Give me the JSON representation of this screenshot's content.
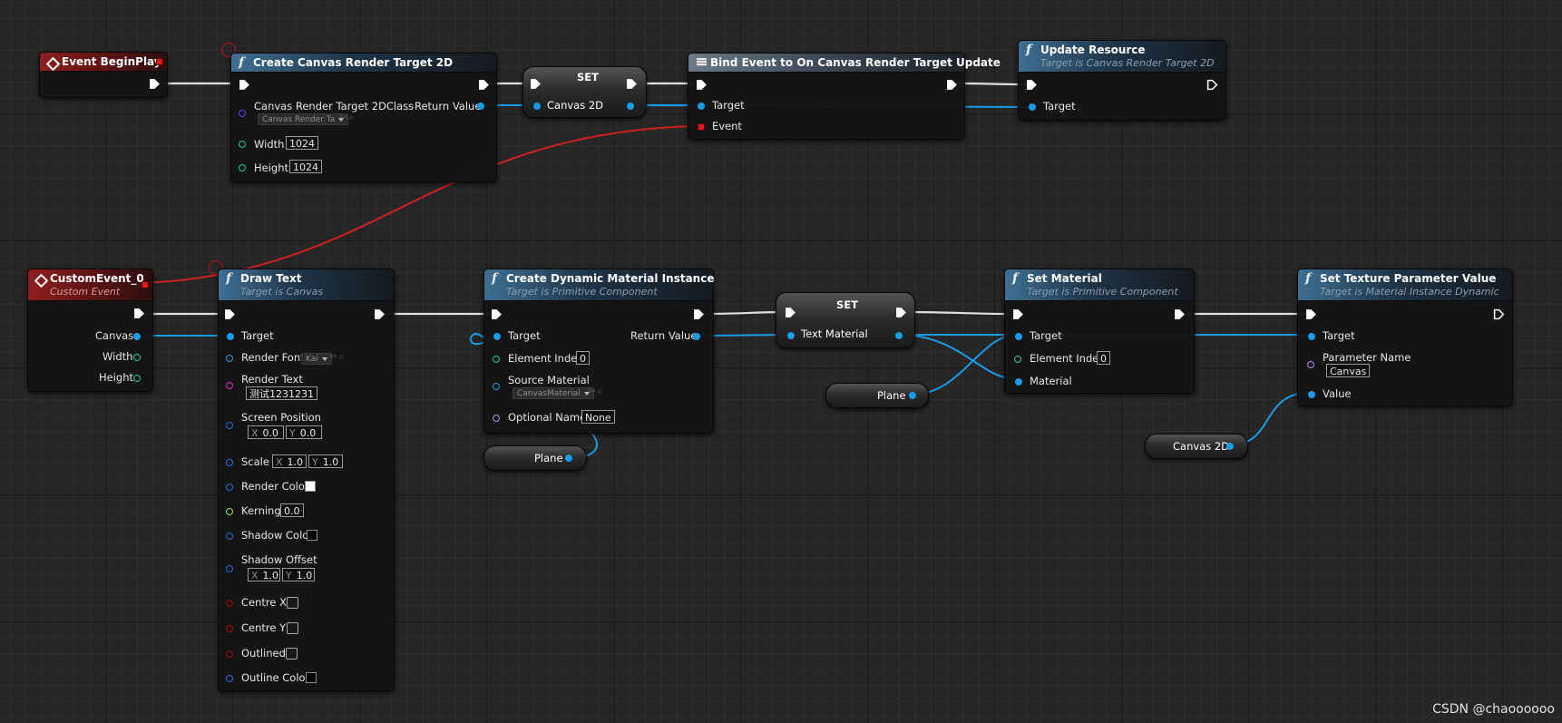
{
  "colors": {
    "exec_pin": "#ffffff",
    "object_pin": "#1a9be6",
    "integer_pin": "#1fc7a6",
    "class_pin": "#6a3fe6",
    "string_pin": "#e52dd6",
    "name_pin": "#b487f7",
    "float_pin": "#9be24f",
    "struct_pin": "#2a6cd8",
    "bool_pin": "#a50d0d",
    "event_header": "#8e1f1f",
    "function_header": "#3f6f93",
    "delegate_pin": "#e01818"
  },
  "nodes": {
    "event_beginplay": {
      "title": "Event BeginPlay"
    },
    "create_canvas_rt": {
      "title": "Create Canvas Render Target 2D",
      "class_label": "Canvas Render Target 2DClass",
      "class_value": "Canvas Render Ta",
      "return_label": "Return Value",
      "width_label": "Width",
      "width_value": "1024",
      "height_label": "Height",
      "height_value": "1024"
    },
    "set_canvas": {
      "title": "SET",
      "pin_label": "Canvas 2D"
    },
    "bind_event": {
      "title": "Bind Event to On Canvas Render Target Update",
      "target_label": "Target",
      "event_label": "Event"
    },
    "update_resource": {
      "title": "Update Resource",
      "subtitle": "Target is Canvas Render Target 2D",
      "target_label": "Target"
    },
    "custom_event": {
      "title": "CustomEvent_0",
      "subtitle": "Custom Event",
      "canvas_label": "Canvas",
      "width_label": "Width",
      "height_label": "Height"
    },
    "draw_text": {
      "title": "Draw Text",
      "subtitle": "Target is Canvas",
      "target_label": "Target",
      "font_label": "Render Font",
      "font_value": "Kai",
      "text_label": "Render Text",
      "text_value": "测试1231231",
      "screen_pos_label": "Screen Position",
      "screen_pos_x": "0.0",
      "screen_pos_y": "0.0",
      "scale_label": "Scale",
      "scale_x": "1.0",
      "scale_y": "1.0",
      "color_label": "Render Color",
      "kerning_label": "Kerning",
      "kerning_value": "0.0",
      "shadow_color_label": "Shadow Color",
      "shadow_offset_label": "Shadow Offset",
      "shadow_offset_x": "1.0",
      "shadow_offset_y": "1.0",
      "centre_x_label": "Centre X",
      "centre_y_label": "Centre Y",
      "outlined_label": "Outlined",
      "outline_color_label": "Outline Color",
      "x_prefix": "X",
      "y_prefix": "Y",
      "render_color": "#ffffff",
      "shadow_color": "#000000",
      "outline_color": "#000000"
    },
    "create_dmi": {
      "title": "Create Dynamic Material Instance",
      "subtitle": "Target is Primitive Component",
      "target_label": "Target",
      "return_label": "Return Value",
      "element_index_label": "Element Index",
      "element_index_value": "0",
      "source_material_label": "Source Material",
      "source_material_value": "CanvasMaterial",
      "optional_name_label": "Optional Name",
      "optional_name_value": "None"
    },
    "set_text_material": {
      "title": "SET",
      "pin_label": "Text Material"
    },
    "set_material": {
      "title": "Set Material",
      "subtitle": "Target is Primitive Component",
      "target_label": "Target",
      "element_index_label": "Element Index",
      "element_index_value": "0",
      "material_label": "Material"
    },
    "set_texture_param": {
      "title": "Set Texture Parameter Value",
      "subtitle": "Target is Material Instance Dynamic",
      "target_label": "Target",
      "param_name_label": "Parameter Name",
      "param_name_value": "Canvas",
      "value_label": "Value"
    }
  },
  "variables": {
    "plane_1": "Plane",
    "plane_2": "Plane",
    "canvas_2d": "Canvas 2D"
  },
  "watermark": "CSDN @chaoooooo"
}
